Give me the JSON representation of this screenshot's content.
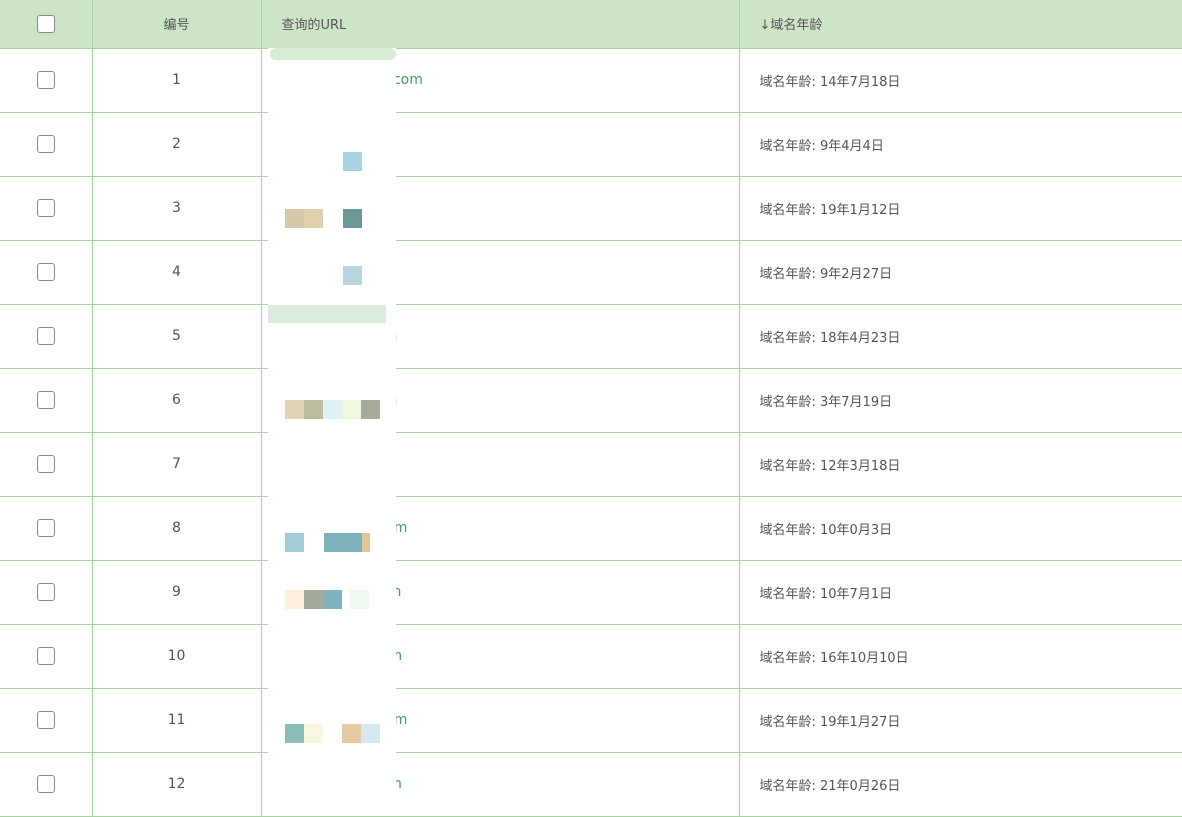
{
  "header": {
    "select_all": "",
    "col_id": "编号",
    "col_url": "查询的URL",
    "col_age": "↓域名年龄"
  },
  "rows": [
    {
      "id": "1",
      "url_suffix": ".com",
      "age": "域名年龄: 14年7月18日"
    },
    {
      "id": "2",
      "url_suffix": "",
      "age": "域名年龄: 9年4月4日"
    },
    {
      "id": "3",
      "url_suffix": "",
      "age": "域名年龄: 19年1月12日"
    },
    {
      "id": "4",
      "url_suffix": "",
      "age": "域名年龄: 9年2月27日"
    },
    {
      "id": "5",
      "url_suffix": "n",
      "age": "域名年龄: 18年4月23日"
    },
    {
      "id": "6",
      "url_suffix": "n",
      "age": "域名年龄: 3年7月19日"
    },
    {
      "id": "7",
      "url_suffix": "",
      "age": "域名年龄: 12年3月18日"
    },
    {
      "id": "8",
      "url_suffix": "com",
      "age": "域名年龄: 10年0月3日"
    },
    {
      "id": "9",
      "url_suffix": "com",
      "age": "域名年龄: 10年7月1日"
    },
    {
      "id": "10",
      "url_suffix": "m",
      "age": "域名年龄: 16年10月10日"
    },
    {
      "id": "11",
      "url_suffix": "com",
      "age": "域名年龄: 19年1月27日"
    },
    {
      "id": "12",
      "url_suffix": ".com",
      "age": "域名年龄: 21年0月26日"
    }
  ],
  "colors": {
    "header_bg": "#cce5c6",
    "grid_line": "#a9d1a3",
    "url_text": "#4a9a6e"
  }
}
